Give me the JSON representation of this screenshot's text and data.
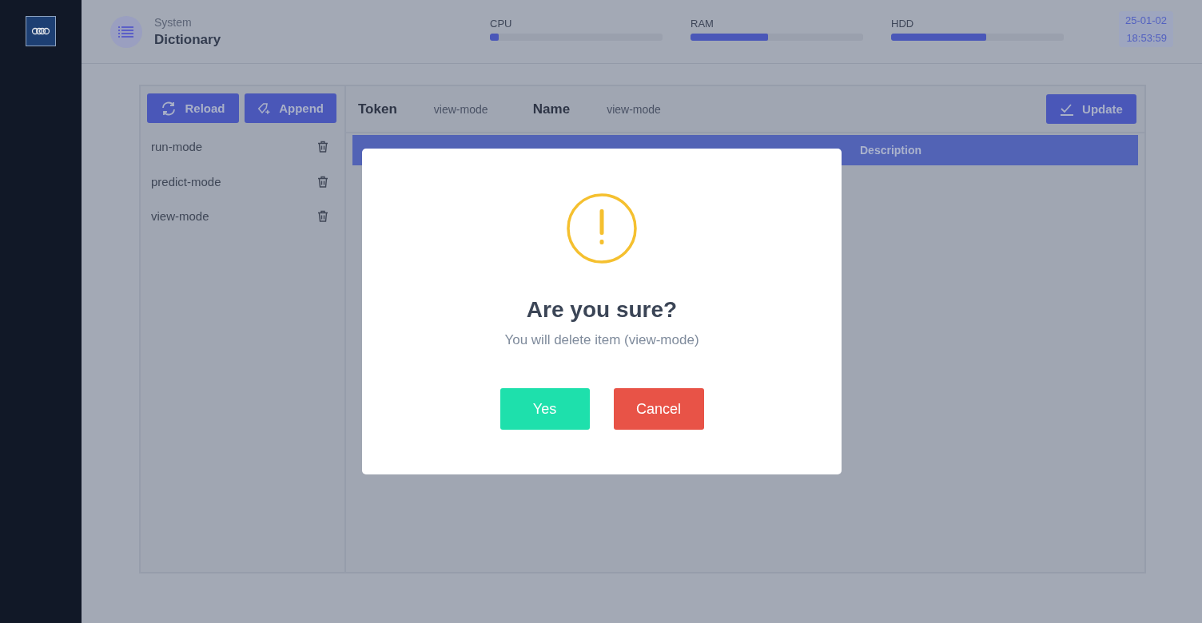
{
  "header": {
    "section": "System",
    "title": "Dictionary",
    "meters": [
      {
        "label": "CPU",
        "level": 0.05
      },
      {
        "label": "RAM",
        "level": 0.45
      },
      {
        "label": "HDD",
        "level": 0.55
      }
    ],
    "date": "25-01-02",
    "time": "18:53:59"
  },
  "toolbar": {
    "buttons": [
      {
        "kind": "reload",
        "label": "Reload"
      },
      {
        "kind": "append",
        "label": "Append"
      }
    ]
  },
  "items": [
    {
      "label": "run-mode"
    },
    {
      "label": "predict-mode"
    },
    {
      "label": "view-mode"
    }
  ],
  "detail": {
    "token_label": "Token",
    "token": "view-mode",
    "name_label": "Name",
    "name": "view-mode",
    "update": "Update"
  },
  "table": {
    "columns": [
      "Description"
    ]
  },
  "dialog": {
    "title": "Are you sure?",
    "message": "You will delete item (view-mode)",
    "buttons": [
      {
        "kind": "confirm",
        "label": "Yes"
      },
      {
        "kind": "cancel",
        "label": "Cancel"
      }
    ]
  }
}
